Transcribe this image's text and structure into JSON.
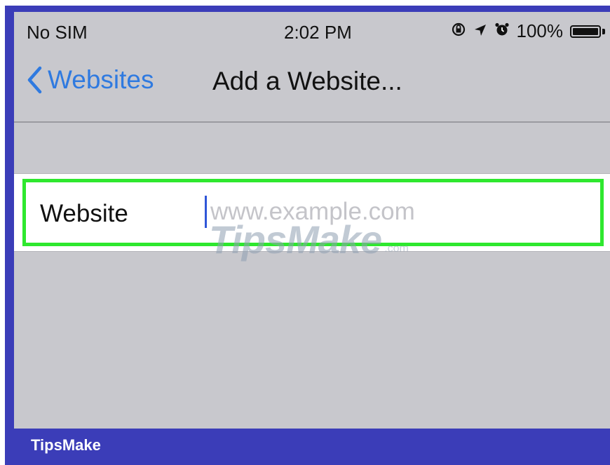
{
  "status_bar": {
    "carrier": "No SIM",
    "time": "2:02 PM",
    "icons": [
      "orientation-lock-icon",
      "location-arrow-icon",
      "alarm-icon"
    ],
    "battery_percent": "100%",
    "battery_level": 1.0
  },
  "nav": {
    "back_label": "Websites",
    "title": "Add a Website..."
  },
  "form": {
    "row_label": "Website",
    "input_value": "",
    "input_placeholder": "www.example.com"
  },
  "watermark": {
    "text": "TipsMake",
    "suffix": ".com"
  },
  "footer": {
    "brand": "TipsMake"
  },
  "colors": {
    "accent": "#2f7ae0",
    "highlight": "#2ee82e",
    "frame": "#3b3db8",
    "background": "#c8c8cd"
  }
}
